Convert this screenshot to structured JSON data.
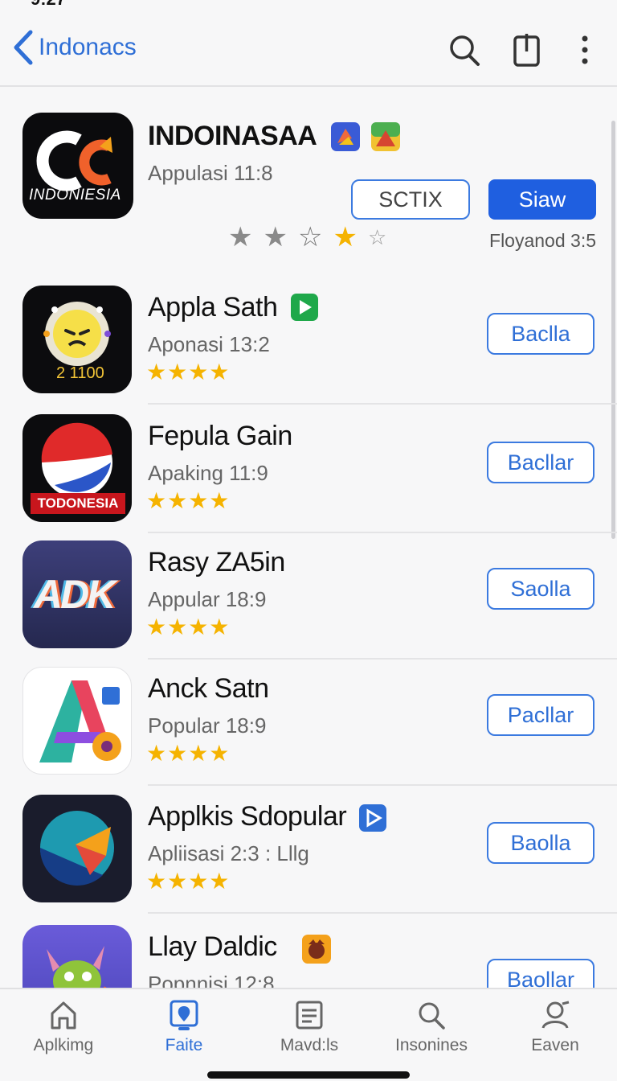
{
  "status": {
    "time": "9:27"
  },
  "nav": {
    "back_label": "Indonacs"
  },
  "featured": {
    "title": "INDOINASAA",
    "icon_text": "INDONIESIA",
    "subtitle": "Appulasi 11:8",
    "secondary_button": "SCTIX",
    "primary_button": "Siaw",
    "side_text": "Floyanod 3:5",
    "rating": 1
  },
  "apps": [
    {
      "title": "Appla Sath",
      "subtitle": "Aponasi 13:2",
      "button": "Baclla",
      "icon_text": "2 1100",
      "stars": "★★★★"
    },
    {
      "title": "Fepula Gain",
      "subtitle": "Apaking 11:9",
      "button": "Bacllar",
      "icon_text": "TODONESIA",
      "stars": "★★★★"
    },
    {
      "title": "Rasy ZA5in",
      "subtitle": "Appular 18:9",
      "button": "Saolla",
      "icon_text": "ADK",
      "stars": "★★★★"
    },
    {
      "title": "Anck Satn",
      "subtitle": "Popular 18:9",
      "button": "Pacllar",
      "icon_text": "A",
      "stars": "★★★★"
    },
    {
      "title": "Applkis Sdopular",
      "subtitle": "Apliisasi 2:3 : Lllg",
      "button": "Baolla",
      "icon_text": "",
      "stars": "★★★★"
    },
    {
      "title": "Llay Daldic",
      "subtitle": "Popnnisi 12:8",
      "button": "Baollar",
      "icon_text": "",
      "stars": "★★★★"
    }
  ],
  "tabs": [
    {
      "label": "Aplkimg",
      "icon": "home-icon"
    },
    {
      "label": "Faite",
      "icon": "location-icon"
    },
    {
      "label": "Mavd:ls",
      "icon": "news-icon"
    },
    {
      "label": "Insonines",
      "icon": "search-icon"
    },
    {
      "label": "Eaven",
      "icon": "person-icon"
    }
  ],
  "colors": {
    "accent": "#2f6fd6",
    "primary_button": "#1f5fe0",
    "star": "#f5b300"
  }
}
